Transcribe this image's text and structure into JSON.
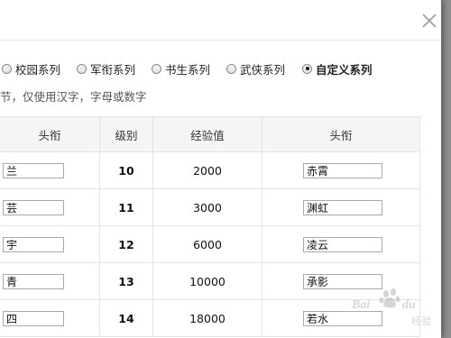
{
  "dialog": {
    "close_icon": "close-icon"
  },
  "series": {
    "options": [
      {
        "label": "校园系列",
        "checked": false
      },
      {
        "label": "军衔系列",
        "checked": false
      },
      {
        "label": "书生系列",
        "checked": false
      },
      {
        "label": "武侠系列",
        "checked": false
      },
      {
        "label": "自定义系列",
        "checked": true
      }
    ]
  },
  "hint": "节，仅使用汉字，字母或数字",
  "table": {
    "headers": [
      "头衔",
      "级别",
      "经验值",
      "头衔"
    ],
    "rows": [
      {
        "left_title": "兰",
        "level": "10",
        "exp": "2000",
        "right_title": "赤霄"
      },
      {
        "left_title": "芸",
        "level": "11",
        "exp": "3000",
        "right_title": "渊虹"
      },
      {
        "left_title": "宇",
        "level": "12",
        "exp": "6000",
        "right_title": "凌云"
      },
      {
        "left_title": "青",
        "level": "13",
        "exp": "10000",
        "right_title": "承影"
      },
      {
        "left_title": "四",
        "level": "14",
        "exp": "18000",
        "right_title": "若水"
      }
    ]
  },
  "watermark": {
    "icon": "baidu-paw-logo",
    "text": "Bai du 经验"
  }
}
